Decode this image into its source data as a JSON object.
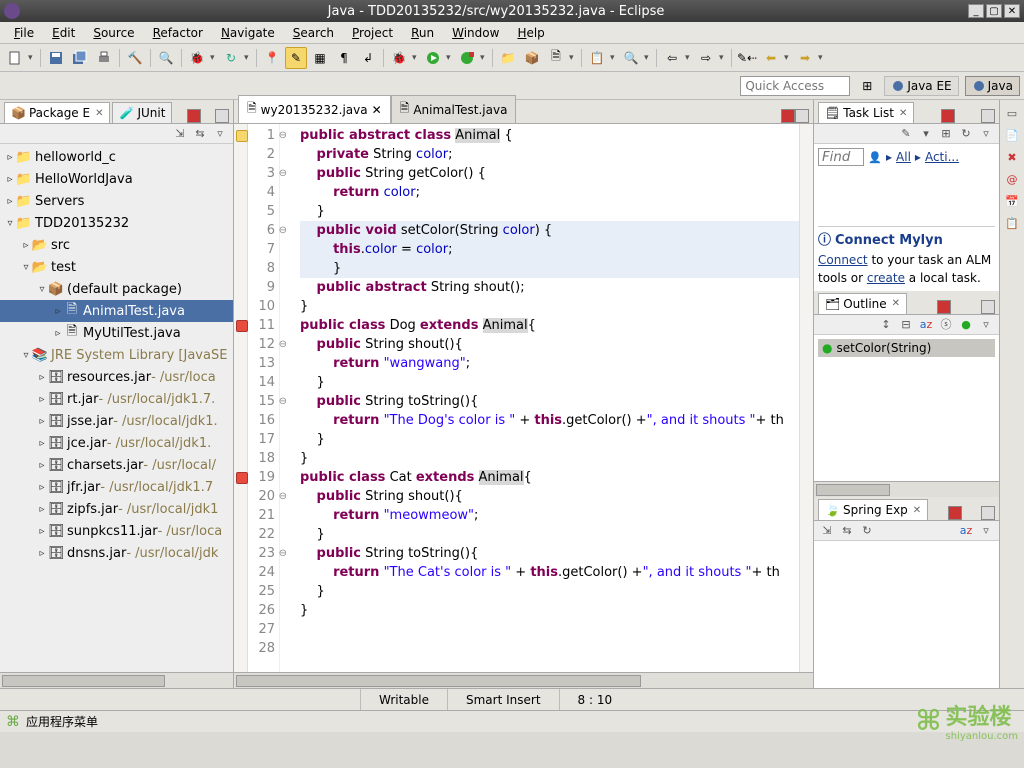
{
  "window": {
    "title": "Java - TDD20135232/src/wy20135232.java - Eclipse"
  },
  "menus": [
    "File",
    "Edit",
    "Source",
    "Refactor",
    "Navigate",
    "Search",
    "Project",
    "Run",
    "Window",
    "Help"
  ],
  "quick_access_placeholder": "Quick Access",
  "perspectives": [
    {
      "label": "Java EE",
      "active": false
    },
    {
      "label": "Java",
      "active": true
    }
  ],
  "left_tabs": [
    {
      "label": "Package E",
      "active": true
    },
    {
      "label": "JUnit",
      "active": false
    }
  ],
  "tree": [
    {
      "d": 0,
      "exp": "▹",
      "icon": "proj-c",
      "label": "helloworld_c"
    },
    {
      "d": 0,
      "exp": "▹",
      "icon": "proj-j",
      "label": "HelloWorldJava"
    },
    {
      "d": 0,
      "exp": "▹",
      "icon": "proj",
      "label": "Servers"
    },
    {
      "d": 0,
      "exp": "▿",
      "icon": "proj-j",
      "label": "TDD20135232"
    },
    {
      "d": 1,
      "exp": "▹",
      "icon": "srcfolder",
      "label": "src"
    },
    {
      "d": 1,
      "exp": "▿",
      "icon": "srcfolder",
      "label": "test"
    },
    {
      "d": 2,
      "exp": "▿",
      "icon": "pkg",
      "label": "(default package)"
    },
    {
      "d": 3,
      "exp": "▹",
      "icon": "jfile",
      "label": "AnimalTest.java",
      "sel": true
    },
    {
      "d": 3,
      "exp": "▹",
      "icon": "jfile",
      "label": "MyUtilTest.java"
    },
    {
      "d": 1,
      "exp": "▿",
      "icon": "jre",
      "label": "JRE System Library",
      "suffix": "[JavaSE"
    },
    {
      "d": 2,
      "exp": "▹",
      "icon": "jar",
      "label": "resources.jar",
      "suffix": " - /usr/loca"
    },
    {
      "d": 2,
      "exp": "▹",
      "icon": "jar",
      "label": "rt.jar",
      "suffix": " - /usr/local/jdk1.7."
    },
    {
      "d": 2,
      "exp": "▹",
      "icon": "jar",
      "label": "jsse.jar",
      "suffix": " - /usr/local/jdk1."
    },
    {
      "d": 2,
      "exp": "▹",
      "icon": "jar",
      "label": "jce.jar",
      "suffix": " - /usr/local/jdk1."
    },
    {
      "d": 2,
      "exp": "▹",
      "icon": "jar",
      "label": "charsets.jar",
      "suffix": " - /usr/local/"
    },
    {
      "d": 2,
      "exp": "▹",
      "icon": "jar",
      "label": "jfr.jar",
      "suffix": " - /usr/local/jdk1.7"
    },
    {
      "d": 2,
      "exp": "▹",
      "icon": "jar",
      "label": "zipfs.jar",
      "suffix": " - /usr/local/jdk1"
    },
    {
      "d": 2,
      "exp": "▹",
      "icon": "jar",
      "label": "sunpkcs11.jar",
      "suffix": " - /usr/loca"
    },
    {
      "d": 2,
      "exp": "▹",
      "icon": "jar",
      "label": "dnsns.jar",
      "suffix": " - /usr/local/jdk"
    }
  ],
  "editor_tabs": [
    {
      "label": "wy20135232.java",
      "active": true
    },
    {
      "label": "AnimalTest.java",
      "active": false
    }
  ],
  "gutter": [
    {
      "n": 1,
      "w": true,
      "fold": true
    },
    {
      "n": 2
    },
    {
      "n": 3,
      "fold": true
    },
    {
      "n": 4
    },
    {
      "n": 5
    },
    {
      "n": 6,
      "fold": true
    },
    {
      "n": 7
    },
    {
      "n": 8
    },
    {
      "n": 9
    },
    {
      "n": 10
    },
    {
      "n": 11,
      "e": true
    },
    {
      "n": 12,
      "fold": true
    },
    {
      "n": 13
    },
    {
      "n": 14
    },
    {
      "n": 15,
      "fold": true
    },
    {
      "n": 16
    },
    {
      "n": 17
    },
    {
      "n": 18
    },
    {
      "n": 19,
      "e": true
    },
    {
      "n": 20,
      "fold": true
    },
    {
      "n": 21
    },
    {
      "n": 22
    },
    {
      "n": 23,
      "fold": true
    },
    {
      "n": 24
    },
    {
      "n": 25
    },
    {
      "n": 26
    },
    {
      "n": 27
    },
    {
      "n": 28
    }
  ],
  "code_lines": [
    {
      "html": "<span class='kw'>public abstract class</span> <span class='typ'>Animal</span> {"
    },
    {
      "html": "    <span class='kw'>private</span> String <span class='fld'>color</span>;"
    },
    {
      "html": "    <span class='kw'>public</span> String getColor() {"
    },
    {
      "html": "        <span class='kw'>return</span> <span class='fld'>color</span>;"
    },
    {
      "html": "    }"
    },
    {
      "html": "    <span class='kw'>public void</span> setColor(String <span class='fld'>color</span>) {",
      "hl": true
    },
    {
      "html": "        <span class='kw'>this</span>.<span class='fld'>color</span> = <span class='fld'>color</span>;",
      "hl": true
    },
    {
      "html": "        }",
      "hl": true
    },
    {
      "html": "    <span class='kw'>public abstract</span> String shout();"
    },
    {
      "html": "}"
    },
    {
      "html": "<span class='kw'>public class</span> <span>Dog</span> <span class='kw'>extends</span> <span class='typ'>Animal</span>{"
    },
    {
      "html": "    <span class='kw'>public</span> String shout(){"
    },
    {
      "html": "        <span class='kw'>return</span> <span class='str'>\"wangwang\"</span>;"
    },
    {
      "html": "    }"
    },
    {
      "html": "    <span class='kw'>public</span> String toString(){"
    },
    {
      "html": "        <span class='kw'>return</span> <span class='str'>\"The Dog's color is \"</span> + <span class='kw'>this</span>.getColor() +<span class='str'>\", and it shouts \"</span>+ th"
    },
    {
      "html": "    }"
    },
    {
      "html": "}"
    },
    {
      "html": "<span class='kw'>public class</span> <span>Cat</span> <span class='kw'>extends</span> <span class='typ'>Animal</span>{"
    },
    {
      "html": "    <span class='kw'>public</span> String shout(){"
    },
    {
      "html": "        <span class='kw'>return</span> <span class='str'>\"meowmeow\"</span>;"
    },
    {
      "html": "    }"
    },
    {
      "html": "    <span class='kw'>public</span> String toString(){"
    },
    {
      "html": "        <span class='kw'>return</span> <span class='str'>\"The Cat's color is \"</span> + <span class='kw'>this</span>.getColor() +<span class='str'>\", and it shouts \"</span>+ th"
    },
    {
      "html": "    }"
    },
    {
      "html": "}"
    },
    {
      "html": ""
    },
    {
      "html": ""
    }
  ],
  "status": {
    "writable": "Writable",
    "insert": "Smart Insert",
    "pos": "8 : 10"
  },
  "footer_label": "应用程序菜单",
  "tasklist": {
    "title": "Task List",
    "find_placeholder": "Find",
    "all": "All",
    "acti": "Acti...",
    "mylyn_title": "Connect Mylyn",
    "mylyn_text1": "Connect",
    "mylyn_text2": " to your task an ALM tools or ",
    "mylyn_text3": "create",
    "mylyn_text4": " a local task."
  },
  "outline": {
    "title": "Outline",
    "item": "setColor(String)"
  },
  "spring": {
    "title": "Spring Exp"
  },
  "watermark": {
    "big": "实验楼",
    "small": "shiyanlou.com"
  }
}
